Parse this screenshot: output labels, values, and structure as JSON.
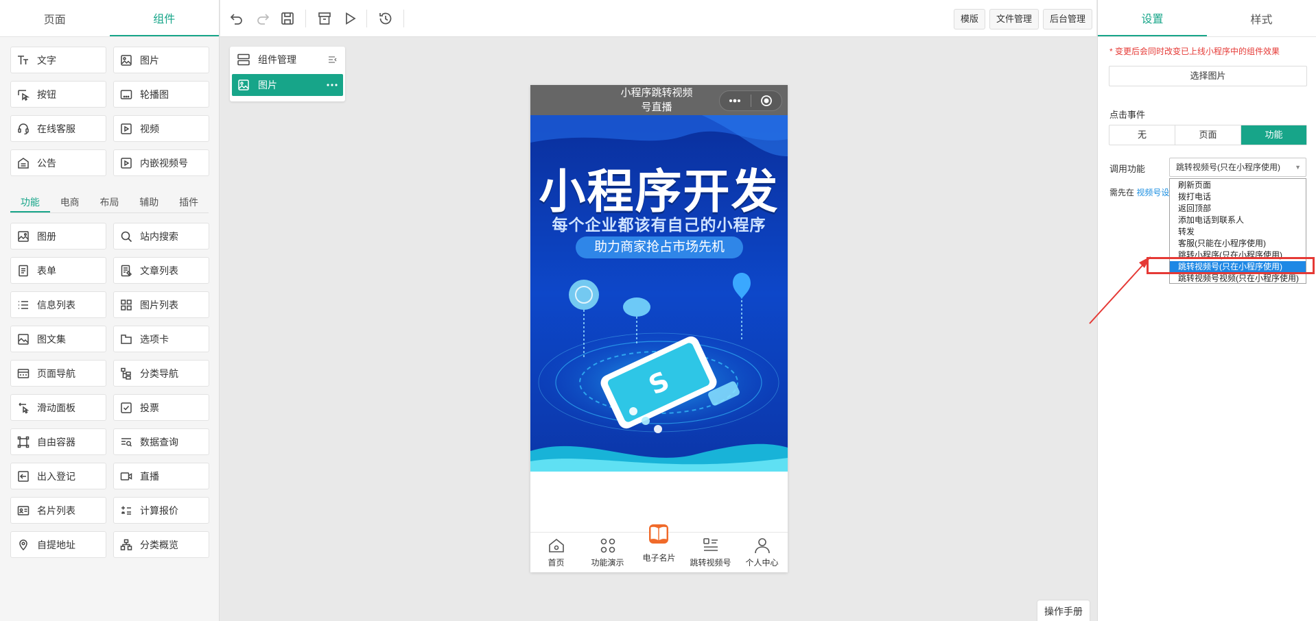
{
  "left": {
    "tabs": [
      "页面",
      "组件"
    ],
    "basic": [
      {
        "label": "文字",
        "icon": "text-icon"
      },
      {
        "label": "图片",
        "icon": "image-icon"
      },
      {
        "label": "按钮",
        "icon": "button-icon"
      },
      {
        "label": "轮播图",
        "icon": "carousel-icon"
      },
      {
        "label": "在线客服",
        "icon": "headset-icon"
      },
      {
        "label": "视频",
        "icon": "video-icon"
      },
      {
        "label": "公告",
        "icon": "notice-icon"
      },
      {
        "label": "内嵌视频号",
        "icon": "channel-video-icon"
      }
    ],
    "categories": [
      "功能",
      "电商",
      "布局",
      "辅助",
      "插件"
    ],
    "features": [
      {
        "label": "图册",
        "icon": "album-icon"
      },
      {
        "label": "站内搜索",
        "icon": "search-icon"
      },
      {
        "label": "表单",
        "icon": "form-icon"
      },
      {
        "label": "文章列表",
        "icon": "article-list-icon"
      },
      {
        "label": "信息列表",
        "icon": "info-list-icon"
      },
      {
        "label": "图片列表",
        "icon": "image-grid-icon"
      },
      {
        "label": "图文集",
        "icon": "gallery-icon"
      },
      {
        "label": "选项卡",
        "icon": "tabs-icon"
      },
      {
        "label": "页面导航",
        "icon": "page-nav-icon"
      },
      {
        "label": "分类导航",
        "icon": "category-nav-icon"
      },
      {
        "label": "滑动面板",
        "icon": "swipe-panel-icon"
      },
      {
        "label": "投票",
        "icon": "vote-icon"
      },
      {
        "label": "自由容器",
        "icon": "free-container-icon"
      },
      {
        "label": "数据查询",
        "icon": "data-query-icon"
      },
      {
        "label": "出入登记",
        "icon": "register-icon"
      },
      {
        "label": "直播",
        "icon": "live-icon"
      },
      {
        "label": "名片列表",
        "icon": "card-list-icon"
      },
      {
        "label": "计算报价",
        "icon": "calculator-icon"
      },
      {
        "label": "自提地址",
        "icon": "location-icon"
      },
      {
        "label": "分类概览",
        "icon": "category-overview-icon"
      }
    ]
  },
  "toolbar": {
    "icons": [
      "undo-icon",
      "redo-icon",
      "save-icon",
      "archive-icon",
      "preview-play-icon",
      "history-icon"
    ],
    "template_label": "模版",
    "files_label": "文件管理",
    "admin_label": "后台管理"
  },
  "component_manager": {
    "title": "组件管理",
    "selected": "图片"
  },
  "phone": {
    "nav_title_line1": "小程序跳转视频",
    "nav_title_line2": "号直播",
    "banner_title": "小程序开发",
    "banner_subtitle": "每个企业都该有自己的小程序",
    "banner_pill": "助力商家抢占市场先机",
    "tabbar": [
      {
        "label": "首页",
        "icon": "home-icon"
      },
      {
        "label": "功能演示",
        "icon": "grid-icon"
      },
      {
        "label": "电子名片",
        "icon": "book-icon"
      },
      {
        "label": "跳转视频号",
        "icon": "list-icon"
      },
      {
        "label": "个人中心",
        "icon": "user-icon"
      }
    ]
  },
  "help_label": "操作手册",
  "right": {
    "tabs": [
      "设置",
      "样式"
    ],
    "warning": "* 变更后会同时改变已上线小程序中的组件效果",
    "select_image_label": "选择图片",
    "click_event_label": "点击事件",
    "click_event_options": [
      "无",
      "页面",
      "功能"
    ],
    "click_event_selected": "功能",
    "function_label": "调用功能",
    "function_selected": "跳转视频号(只在小程序使用)",
    "note_prefix": "需先在",
    "note_link": "视频号设",
    "function_options": [
      "刷新页面",
      "拨打电话",
      "返回顶部",
      "添加电话到联系人",
      "转发",
      "客服(只能在小程序使用)",
      "跳转小程序(只在小程序使用)",
      "跳转视频号(只在小程序使用)",
      "跳转视频号视频(只在小程序使用)"
    ],
    "highlighted_index": 7
  },
  "colors": {
    "accent": "#17a589",
    "warning": "#e53935",
    "highlight": "#1e88e5",
    "annotation": "#e53935"
  }
}
